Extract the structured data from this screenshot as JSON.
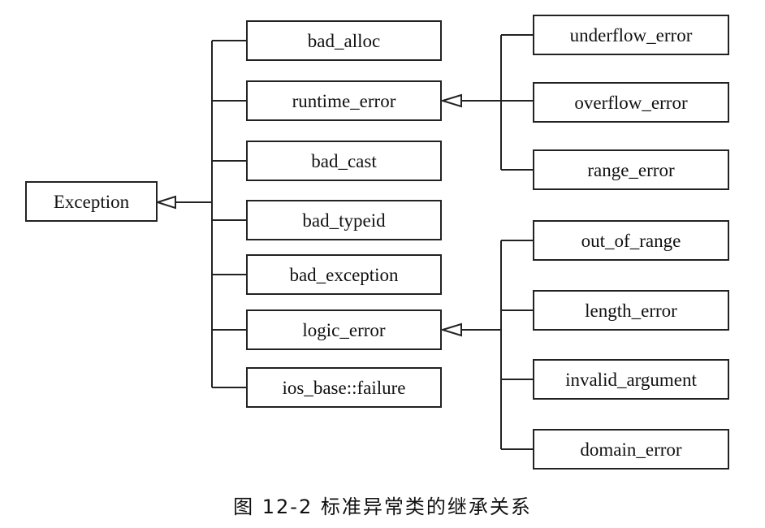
{
  "diagram": {
    "root": {
      "label": "Exception"
    },
    "level1": [
      {
        "label": "bad_alloc"
      },
      {
        "label": "runtime_error"
      },
      {
        "label": "bad_cast"
      },
      {
        "label": "bad_typeid"
      },
      {
        "label": "bad_exception"
      },
      {
        "label": "logic_error"
      },
      {
        "label": "ios_base::failure"
      }
    ],
    "runtime_children": [
      {
        "label": "underflow_error"
      },
      {
        "label": "overflow_error"
      },
      {
        "label": "range_error"
      }
    ],
    "logic_children": [
      {
        "label": "out_of_range"
      },
      {
        "label": "length_error"
      },
      {
        "label": "invalid_argument"
      },
      {
        "label": "domain_error"
      }
    ]
  },
  "caption": {
    "text": "图 12-2   标准异常类的继承关系"
  }
}
